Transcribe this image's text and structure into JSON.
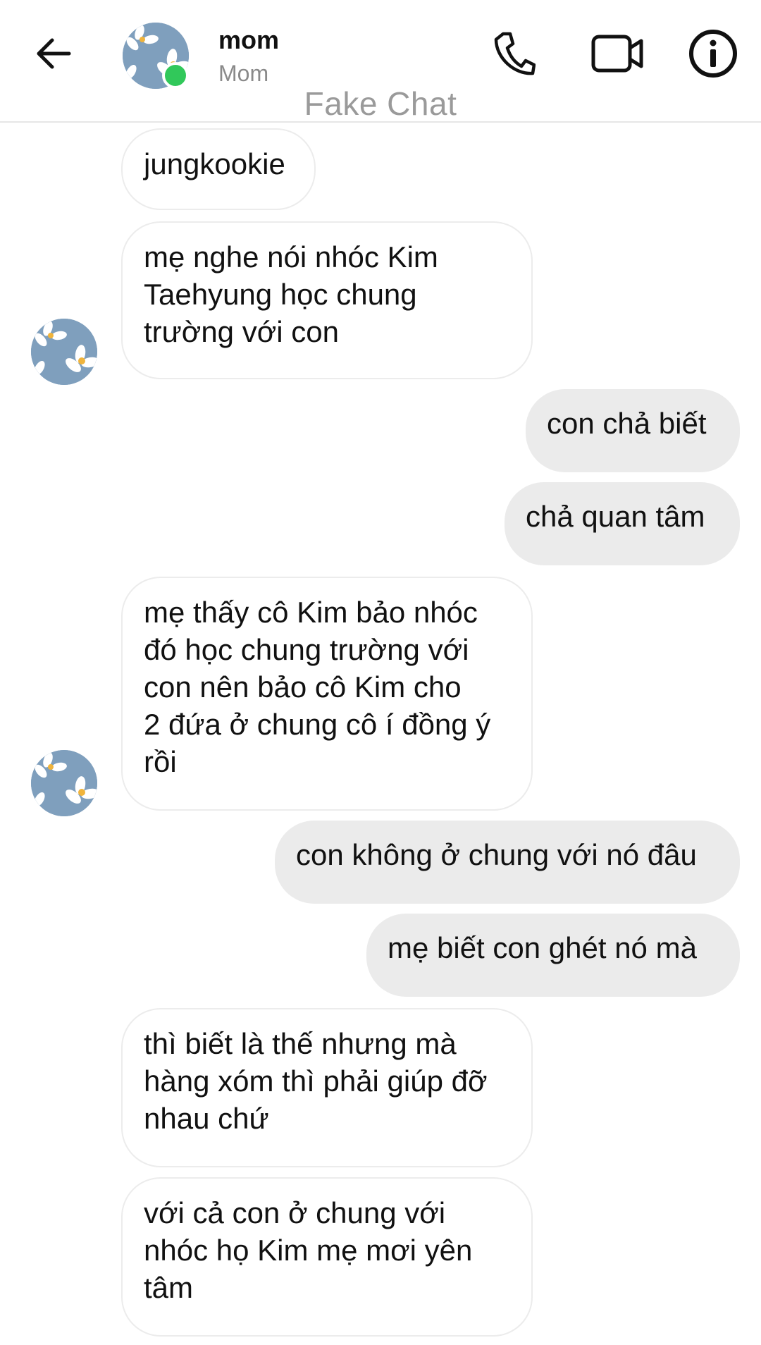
{
  "header": {
    "contact_name": "mom",
    "contact_subtitle": "Mom",
    "watermark": "Fake Chat",
    "icons": [
      "back-arrow-icon",
      "phone-icon",
      "video-camera-icon",
      "info-icon"
    ],
    "online_color": "#31c85a"
  },
  "messages": [
    {
      "side": "received",
      "text": "jungkookie"
    },
    {
      "side": "received",
      "text": "mẹ nghe nói nhóc Kim\nTaehyung học chung\ntrường với con"
    },
    {
      "side": "sent",
      "text": "con chả biết"
    },
    {
      "side": "sent",
      "text": "chả quan tâm"
    },
    {
      "side": "received",
      "text": "mẹ thấy cô Kim bảo nhóc\nđó học chung trường với\ncon nên bảo cô Kim cho\n2 đứa ở chung cô í đồng ý\nrồi"
    },
    {
      "side": "sent",
      "text": "con không ở chung với nó đâu"
    },
    {
      "side": "sent",
      "text": "mẹ biết con ghét nó mà"
    },
    {
      "side": "received",
      "text": "thì biết là thế nhưng mà\nhàng xóm thì phải giúp đỡ\nnhau chứ"
    },
    {
      "side": "received",
      "text": "với cả con ở chung với\nnhóc họ Kim mẹ mơi yên\ntâm"
    }
  ]
}
